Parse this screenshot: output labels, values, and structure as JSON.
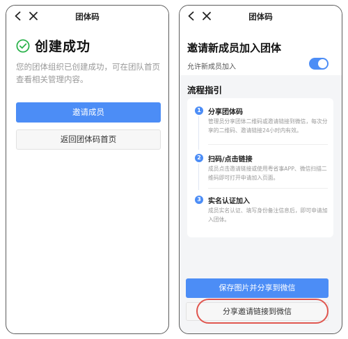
{
  "screen1": {
    "title": "团体码",
    "success_title": "创建成功",
    "description": "您的团体组织已创建成功，可在团队首页查看相关管理内容。",
    "invite_button": "邀请成员",
    "back_button": "返回团体码首页"
  },
  "screen2": {
    "title": "团体码",
    "heading": "邀请新成员加入团体",
    "allow_label": "允许新成员加入",
    "allow_enabled": true,
    "guide_title": "流程指引",
    "steps": [
      {
        "num": "1",
        "title": "分享团体码",
        "desc": "管理员分享团体二维码或邀请链接到微信，每次分享的二维码、邀请链接24小时内有效。"
      },
      {
        "num": "2",
        "title": "扫码/点击链接",
        "desc": "成员点击邀请链接或使用粤省事APP、微信扫描二维码即可打开申请加入页面。"
      },
      {
        "num": "3",
        "title": "实名认证加入",
        "desc": "成员实名认证、填写身份备注信息后，即可申请加入团体。"
      }
    ],
    "save_button": "保存图片并分享到微信",
    "share_link_button": "分享邀请链接到微信"
  },
  "colors": {
    "accent": "#4c8df6",
    "success": "#2bb24c",
    "highlight": "#e0564f"
  },
  "icons": {
    "back": "chevron-left-icon",
    "close": "close-icon",
    "success": "check-circle-icon"
  }
}
